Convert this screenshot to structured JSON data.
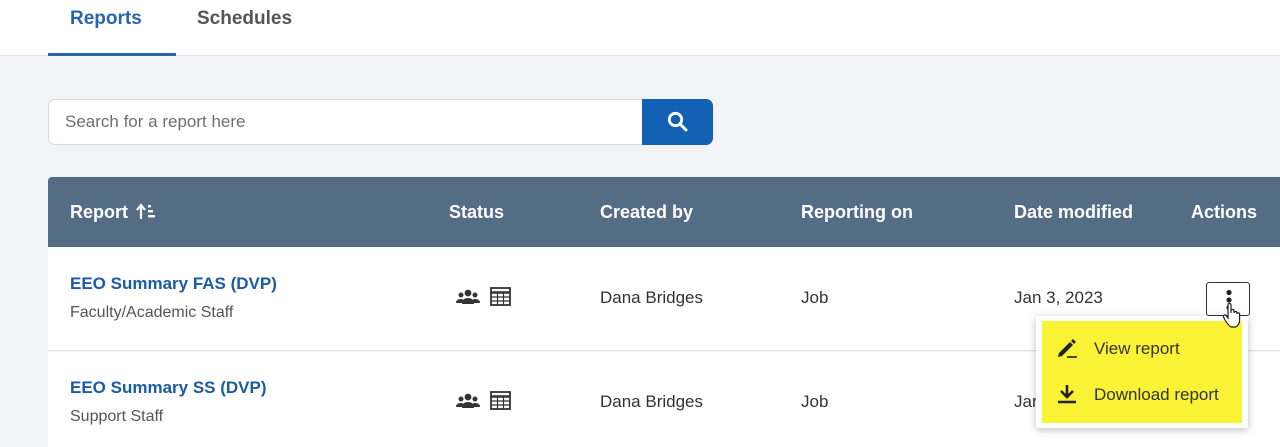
{
  "tabs": [
    {
      "label": "Reports",
      "active": true
    },
    {
      "label": "Schedules",
      "active": false
    }
  ],
  "search": {
    "placeholder": "Search for a report here",
    "value": "",
    "button_icon": "search-icon"
  },
  "table": {
    "headers": {
      "report": "Report",
      "status": "Status",
      "created_by": "Created by",
      "reporting_on": "Reporting on",
      "date_modified": "Date modified",
      "actions": "Actions"
    },
    "sort_icon": "sort-ascending-icon",
    "rows": [
      {
        "title": "EEO Summary FAS (DVP)",
        "subtitle": "Faculty/Academic Staff",
        "status_icons": [
          "users-icon",
          "table-icon"
        ],
        "created_by": "Dana Bridges",
        "reporting_on": "Job",
        "date_modified": "Jan 3, 2023"
      },
      {
        "title": "EEO Summary SS (DVP)",
        "subtitle": "Support Staff",
        "status_icons": [
          "users-icon",
          "table-icon"
        ],
        "created_by": "Dana Bridges",
        "reporting_on": "Job",
        "date_modified": "Jan"
      }
    ]
  },
  "actions_menu": {
    "items": [
      {
        "label": "View report",
        "icon": "pencil-icon"
      },
      {
        "label": "Download report",
        "icon": "download-icon"
      }
    ],
    "highlight_color": "#faf235"
  },
  "colors": {
    "accent": "#2764a8",
    "search_button": "#1361b5",
    "header_bg": "#546c84",
    "link": "#1a5ba6"
  }
}
